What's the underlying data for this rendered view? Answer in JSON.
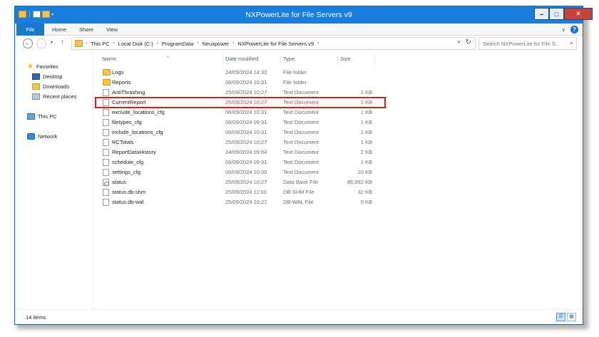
{
  "window": {
    "title": "NXPowerLite for File Servers v9",
    "controls": {
      "minimize": "–",
      "maximize": "□",
      "close": "✕"
    }
  },
  "ribbon": {
    "tabs": [
      "File",
      "Home",
      "Share",
      "View"
    ],
    "expand_glyph": "∨",
    "help_glyph": "?"
  },
  "address": {
    "back_glyph": "←",
    "forward_glyph": "→",
    "recent_glyph": "▾",
    "up_glyph": "↑",
    "crumbs": [
      "This PC",
      "Local Disk (C:)",
      "ProgramData",
      "Neuxpower",
      "NXPowerLite for File Servers v9"
    ],
    "crumb_separator": "›",
    "dropdown_glyph": "∨",
    "refresh_glyph": "↻",
    "search_placeholder": "Search NXPowerLite for File S...",
    "search_glyph": "⌕"
  },
  "navpane": {
    "favorites": "Favorites",
    "favorites_items": [
      "Desktop",
      "Downloads",
      "Recent places"
    ],
    "this_pc": "This PC",
    "network": "Network"
  },
  "columns": {
    "name": "Name",
    "date": "Date modified",
    "type": "Type",
    "size": "Size",
    "sort_glyph": "^"
  },
  "files": [
    {
      "name": "Logs",
      "date": "24/09/2024 14:32",
      "type": "File folder",
      "size": "",
      "icon": "folder-icon"
    },
    {
      "name": "Reports",
      "date": "06/09/2024 10:31",
      "type": "File folder",
      "size": "",
      "icon": "folder-icon"
    },
    {
      "name": "AntiThrashing",
      "date": "25/09/2024 10:27",
      "type": "Text Document",
      "size": "1 KB",
      "icon": "document-icon"
    },
    {
      "name": "CurrentReport",
      "date": "25/09/2024 10:27",
      "type": "Text Document",
      "size": "1 KB",
      "icon": "document-icon"
    },
    {
      "name": "exclude_locations_cfg",
      "date": "06/09/2024 10:31",
      "type": "Text Document",
      "size": "1 KB",
      "icon": "document-icon"
    },
    {
      "name": "filetypes_cfg",
      "date": "06/09/2024 09:31",
      "type": "Text Document",
      "size": "1 KB",
      "icon": "document-icon"
    },
    {
      "name": "include_locations_cfg",
      "date": "06/09/2024 10:31",
      "type": "Text Document",
      "size": "1 KB",
      "icon": "document-icon"
    },
    {
      "name": "RCTotals",
      "date": "25/09/2024 10:27",
      "type": "Text Document",
      "size": "1 KB",
      "icon": "document-icon"
    },
    {
      "name": "ReportDataHistory",
      "date": "24/09/2024 09:04",
      "type": "Text Document",
      "size": "2 KB",
      "icon": "document-icon"
    },
    {
      "name": "schedule_cfg",
      "date": "06/09/2024 09:31",
      "type": "Text Document",
      "size": "1 KB",
      "icon": "document-icon"
    },
    {
      "name": "settings_cfg",
      "date": "06/09/2024 10:30",
      "type": "Text Document",
      "size": "10 KB",
      "icon": "document-icon"
    },
    {
      "name": "status",
      "date": "25/09/2024 10:27",
      "type": "Data Base File",
      "size": "86,992 KB",
      "icon": "database-icon"
    },
    {
      "name": "status.db-shm",
      "date": "25/09/2024 11:00",
      "type": "DB-SHM File",
      "size": "32 KB",
      "icon": "document-icon"
    },
    {
      "name": "status.db-wal",
      "date": "25/09/2024 10:27",
      "type": "DB-WAL File",
      "size": "0 KB",
      "icon": "document-icon"
    }
  ],
  "highlighted_file": "CurrentReport",
  "highlight_color": "#cc1f1f",
  "status": {
    "item_count": "14 items",
    "details_view_glyph": "☰",
    "icons_view_glyph": "▦"
  },
  "colors": {
    "title_bar": "#1a7fdc",
    "file_tab": "#1979ca",
    "close_button": "#c7423a"
  }
}
